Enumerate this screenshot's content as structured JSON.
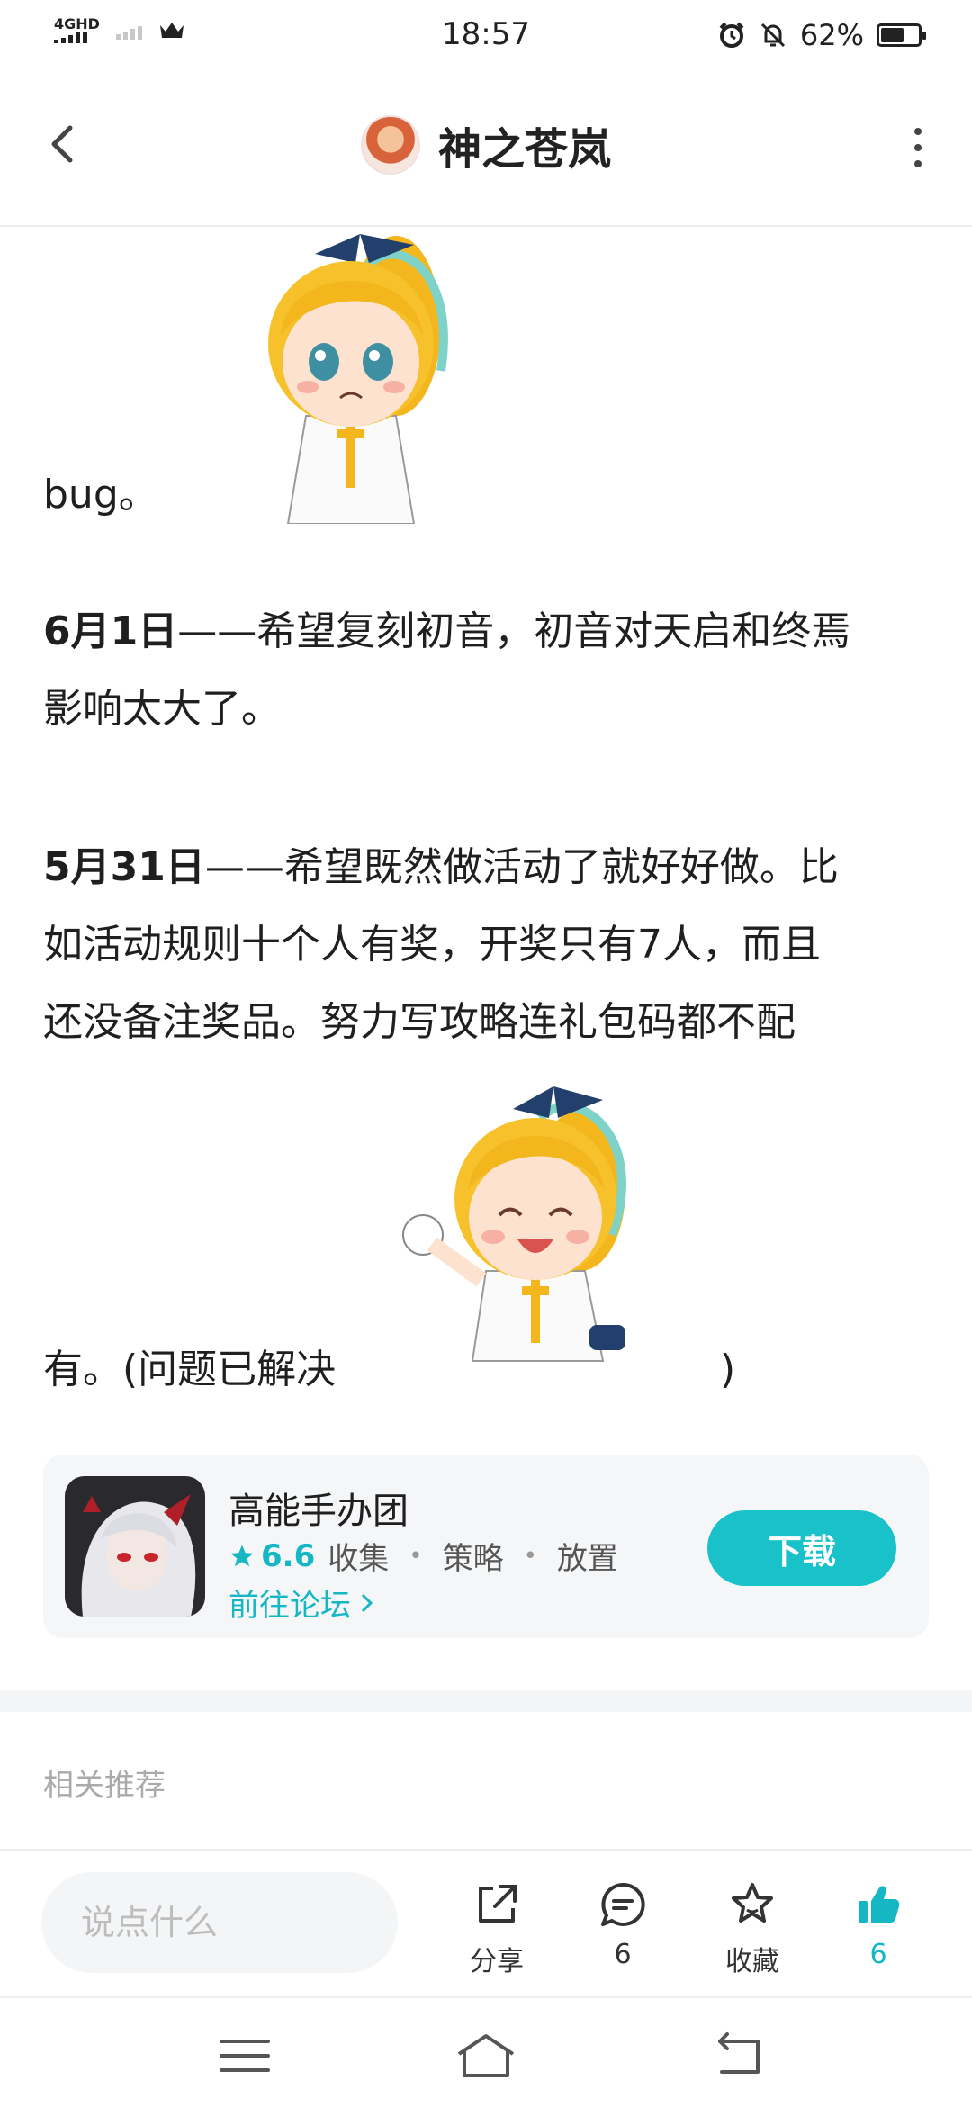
{
  "status_bar": {
    "network_label": "4GHD",
    "time": "18:57",
    "battery_percent": "62%",
    "battery_level": 0.62,
    "icons": [
      "signal-icon",
      "crown-icon",
      "alarm-icon",
      "mute-icon",
      "battery-icon"
    ]
  },
  "header": {
    "title": "神之苍岚",
    "back_icon": "chevron-left-icon",
    "more_icon": "more-vertical-icon"
  },
  "post": {
    "p1_text": "bug。",
    "p2_date": "6月1日",
    "p2_line1": "——希望复刻初音，初音对天启和终焉",
    "p2_line2": "影响太大了。",
    "p3_date": "5月31日",
    "p3_line1": "——希望既然做活动了就好好做。比",
    "p3_line2": "如活动规则十个人有奖，开奖只有7人，而且",
    "p3_line3": "还没备注奖品。努力写攻略连礼包码都不配",
    "p3_line4": "有。(问题已解决",
    "p3_close": ")"
  },
  "app_card": {
    "name": "高能手办团",
    "rating": "6.6",
    "tags": [
      "收集",
      "策略",
      "放置"
    ],
    "forum_link": "前往论坛",
    "download_label": "下载"
  },
  "related": {
    "title": "相关推荐"
  },
  "bottom_bar": {
    "comment_placeholder": "说点什么",
    "share_label": "分享",
    "comment_count": "6",
    "favorite_label": "收藏",
    "like_count": "6",
    "accent_color": "#16b7c4"
  },
  "nav": {
    "icons": [
      "menu-icon",
      "home-icon",
      "back-nav-icon"
    ]
  }
}
